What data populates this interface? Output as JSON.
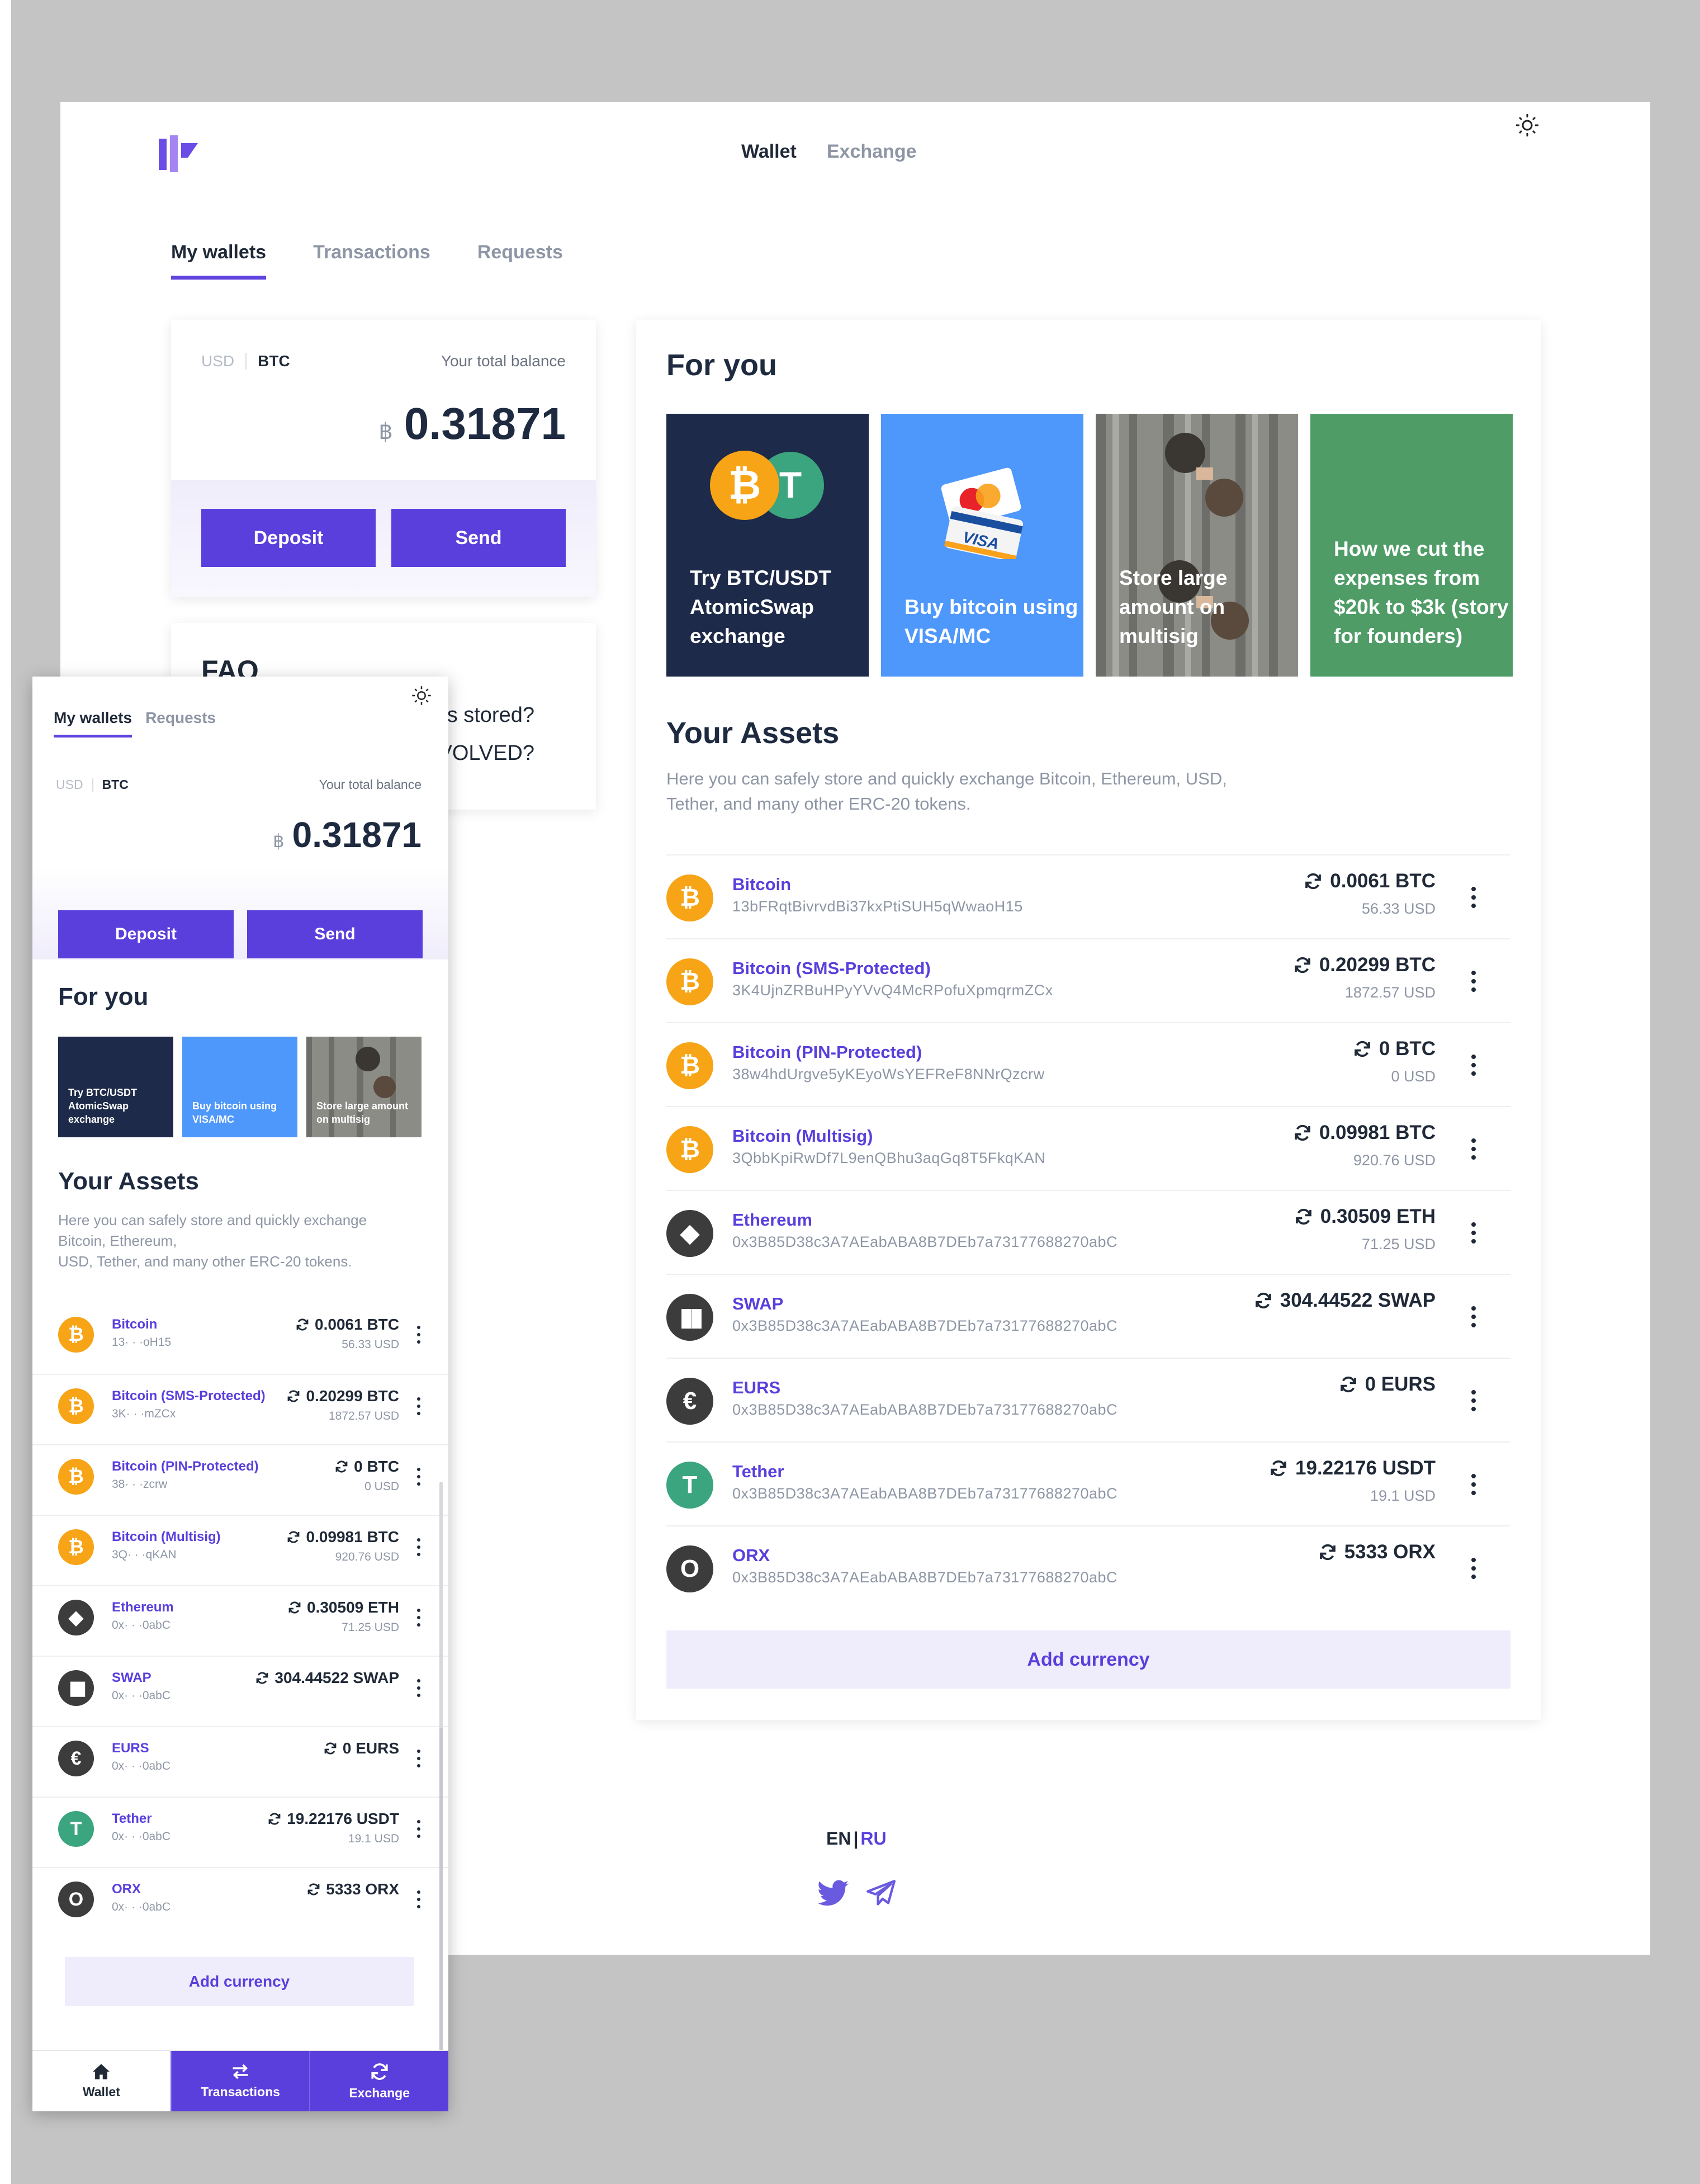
{
  "colors": {
    "accent": "#5a3fdc",
    "btc": "#f7a417",
    "eth": "#3c3c3d",
    "tether": "#3aa57e",
    "tile_dark": "#1e2a49",
    "tile_blue": "#4e97fb",
    "tile_green": "#4f9c67"
  },
  "header": {
    "nav": [
      "Wallet",
      "Exchange"
    ],
    "theme_icon": "sun-icon"
  },
  "tabs": [
    "My wallets",
    "Transactions",
    "Requests"
  ],
  "balance": {
    "currencies": [
      "USD",
      "BTC"
    ],
    "label": "Your total balance",
    "symbol": "฿",
    "amount": "0.31871",
    "deposit": "Deposit",
    "send": "Send"
  },
  "faq": {
    "title": "FAQ",
    "questions": [
      "s stored?",
      "VOLVED?"
    ]
  },
  "for_you": {
    "title": "For you",
    "tiles": [
      "Try BTC/USDT AtomicSwap exchange",
      "Buy bitcoin using VISA/MC",
      "Store large amount on multisig",
      "How we cut the expenses from $20k to $3k (story for founders)"
    ]
  },
  "assets": {
    "title": "Your Assets",
    "description": "Here you can safely store and quickly exchange Bitcoin, Ethereum, USD, Tether, and many other ERC-20 tokens.",
    "mobile_description_line1": "Here you can safely store and quickly exchange Bitcoin, Ethereum,",
    "mobile_description_line2": "USD, Tether, and many other ERC-20 tokens.",
    "items": [
      {
        "name": "Bitcoin",
        "address": "13bFRqtBivrvdBi37kxPtiSUH5qWwaoH15",
        "short": "13· · ·oH15",
        "amount": "0.0061 BTC",
        "usd": "56.33 USD",
        "icon": "bitcoin-icon"
      },
      {
        "name": "Bitcoin (SMS-Protected)",
        "address": "3K4UjnZRBuHPyYVvQ4McRPofuXpmqrmZCx",
        "short": "3K· · ·mZCx",
        "amount": "0.20299 BTC",
        "usd": "1872.57 USD",
        "icon": "bitcoin-icon"
      },
      {
        "name": "Bitcoin (PIN-Protected)",
        "address": "38w4hdUrgve5yKEyoWsYEFReF8NNrQzcrw",
        "short": "38· · ·zcrw",
        "amount": "0 BTC",
        "usd": "0 USD",
        "icon": "bitcoin-icon"
      },
      {
        "name": "Bitcoin (Multisig)",
        "address": "3QbbKpiRwDf7L9enQBhu3aqGq8T5FkqKAN",
        "short": "3Q· · ·qKAN",
        "amount": "0.09981 BTC",
        "usd": "920.76 USD",
        "icon": "bitcoin-icon"
      },
      {
        "name": "Ethereum",
        "address": "0x3B85D38c3A7AEabABA8B7DEb7a73177688270abC",
        "short": "0x· · ·0abC",
        "amount": "0.30509 ETH",
        "usd": "71.25 USD",
        "icon": "ethereum-icon"
      },
      {
        "name": "SWAP",
        "address": "0x3B85D38c3A7AEabABA8B7DEb7a73177688270abC",
        "short": "0x· · ·0abC",
        "amount": "304.44522 SWAP",
        "usd": "",
        "icon": "swap-icon"
      },
      {
        "name": "EURS",
        "address": "0x3B85D38c3A7AEabABA8B7DEb7a73177688270abC",
        "short": "0x· · ·0abC",
        "amount": "0 EURS",
        "usd": "",
        "icon": "euro-icon"
      },
      {
        "name": "Tether",
        "address": "0x3B85D38c3A7AEabABA8B7DEb7a73177688270abC",
        "short": "0x· · ·0abC",
        "amount": "19.22176 USDT",
        "usd": "19.1 USD",
        "icon": "tether-icon"
      },
      {
        "name": "ORX",
        "address": "0x3B85D38c3A7AEabABA8B7DEb7a73177688270abC",
        "short": "0x· · ·0abC",
        "amount": "5333 ORX",
        "usd": "",
        "icon": "orx-icon"
      }
    ],
    "add_currency": "Add currency"
  },
  "footer": {
    "lang_en": "EN",
    "lang_sep": "|",
    "lang_ru": "RU",
    "social": [
      "twitter-icon",
      "telegram-icon"
    ]
  },
  "mobile": {
    "tabs": [
      "My wallets",
      "Requests"
    ],
    "for_you_tiles": [
      "Try BTC/USDT AtomicSwap exchange",
      "Buy bitcoin using VISA/MC",
      "Store large amount on multisig"
    ],
    "bottom_nav": [
      "Wallet",
      "Transactions",
      "Exchange"
    ]
  }
}
